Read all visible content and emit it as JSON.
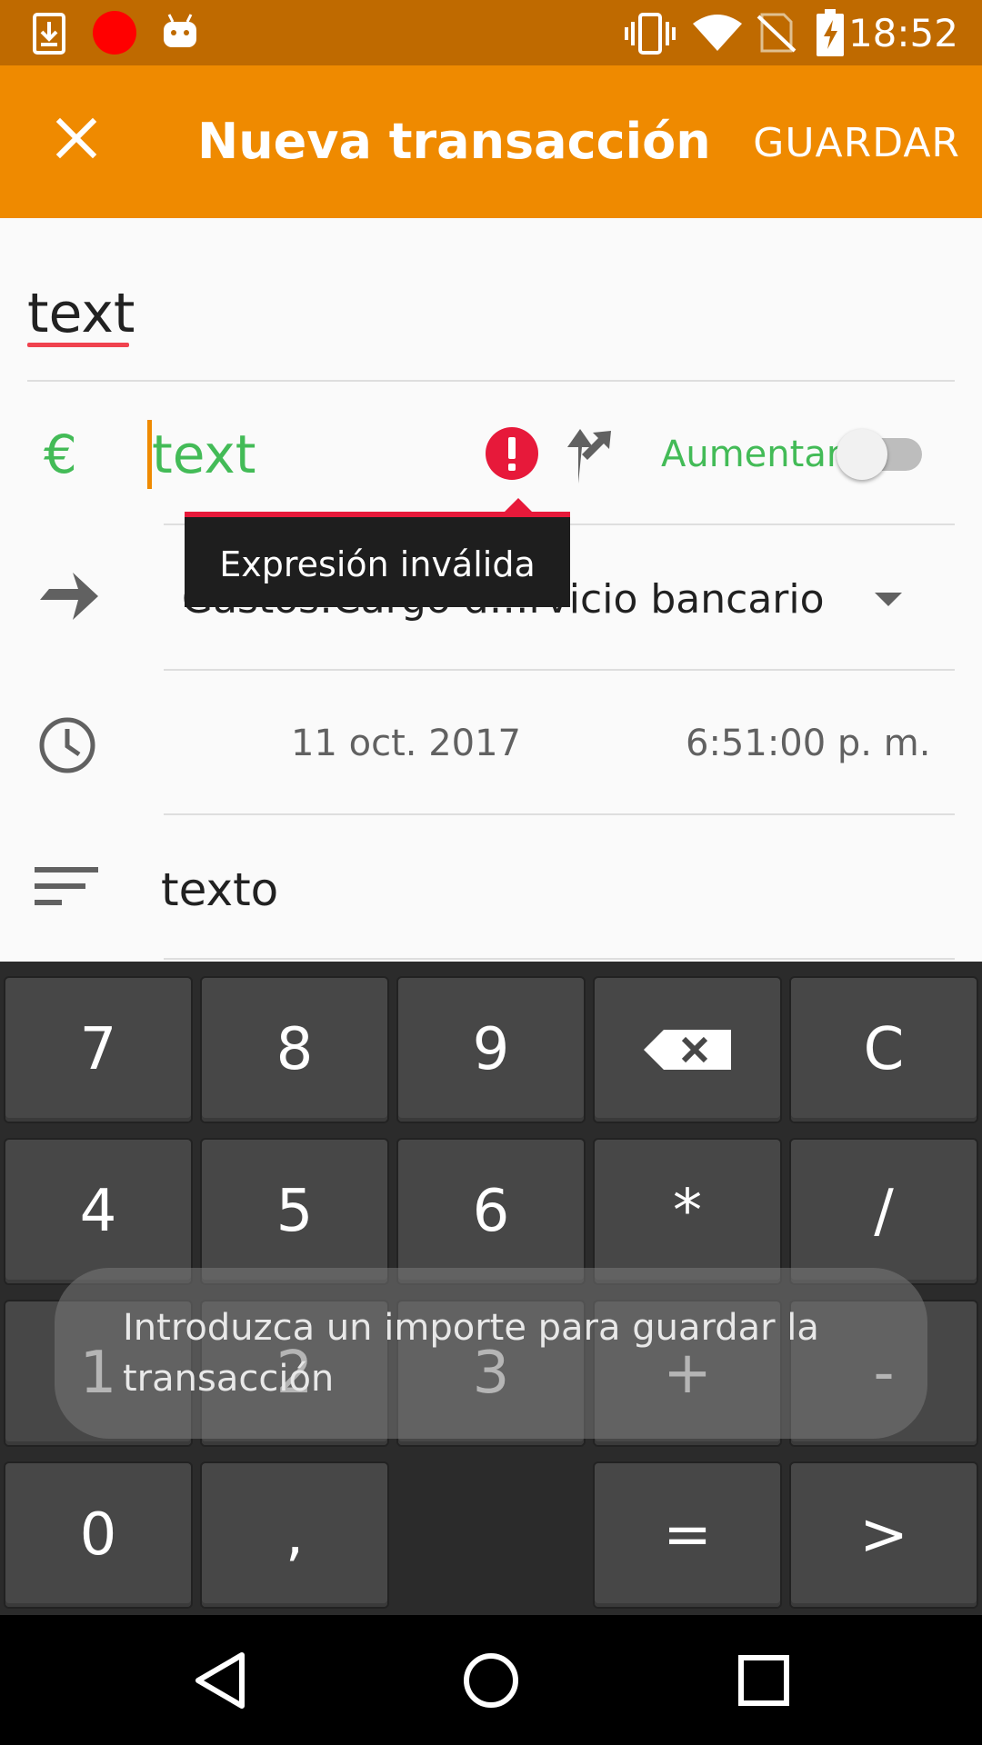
{
  "status_bar": {
    "time": "18:52",
    "icons": [
      "download-icon",
      "record-icon",
      "android-icon",
      "vibrate-icon",
      "wifi-icon",
      "no-signal-icon",
      "battery-charging-icon"
    ]
  },
  "app_bar": {
    "title": "Nueva transacción",
    "save_label": "GUARDAR",
    "close_icon": "close-icon"
  },
  "form": {
    "description": "text",
    "currency_symbol": "€",
    "amount": "text",
    "toggle_label": "Aumentar",
    "toggle_on": false,
    "tooltip": "Expresión inválida",
    "account": "Gastos:Cargo d…rvicio bancario",
    "date": "11 oct. 2017",
    "time": "6:51:00 p. m.",
    "notes": "texto"
  },
  "keypad": {
    "rows": [
      [
        "7",
        "8",
        "9",
        "⌫",
        "C"
      ],
      [
        "4",
        "5",
        "6",
        "*",
        "/"
      ],
      [
        "1",
        "2",
        "3",
        "+",
        "-"
      ],
      [
        "0",
        ",",
        "",
        "=",
        ">"
      ]
    ]
  },
  "toast": {
    "message": "Introduzca un importe para guardar la transacción"
  },
  "colors": {
    "status_bar": "#bf6a00",
    "app_bar": "#ef8a00",
    "green": "#43bb57",
    "error": "#e7193a"
  }
}
